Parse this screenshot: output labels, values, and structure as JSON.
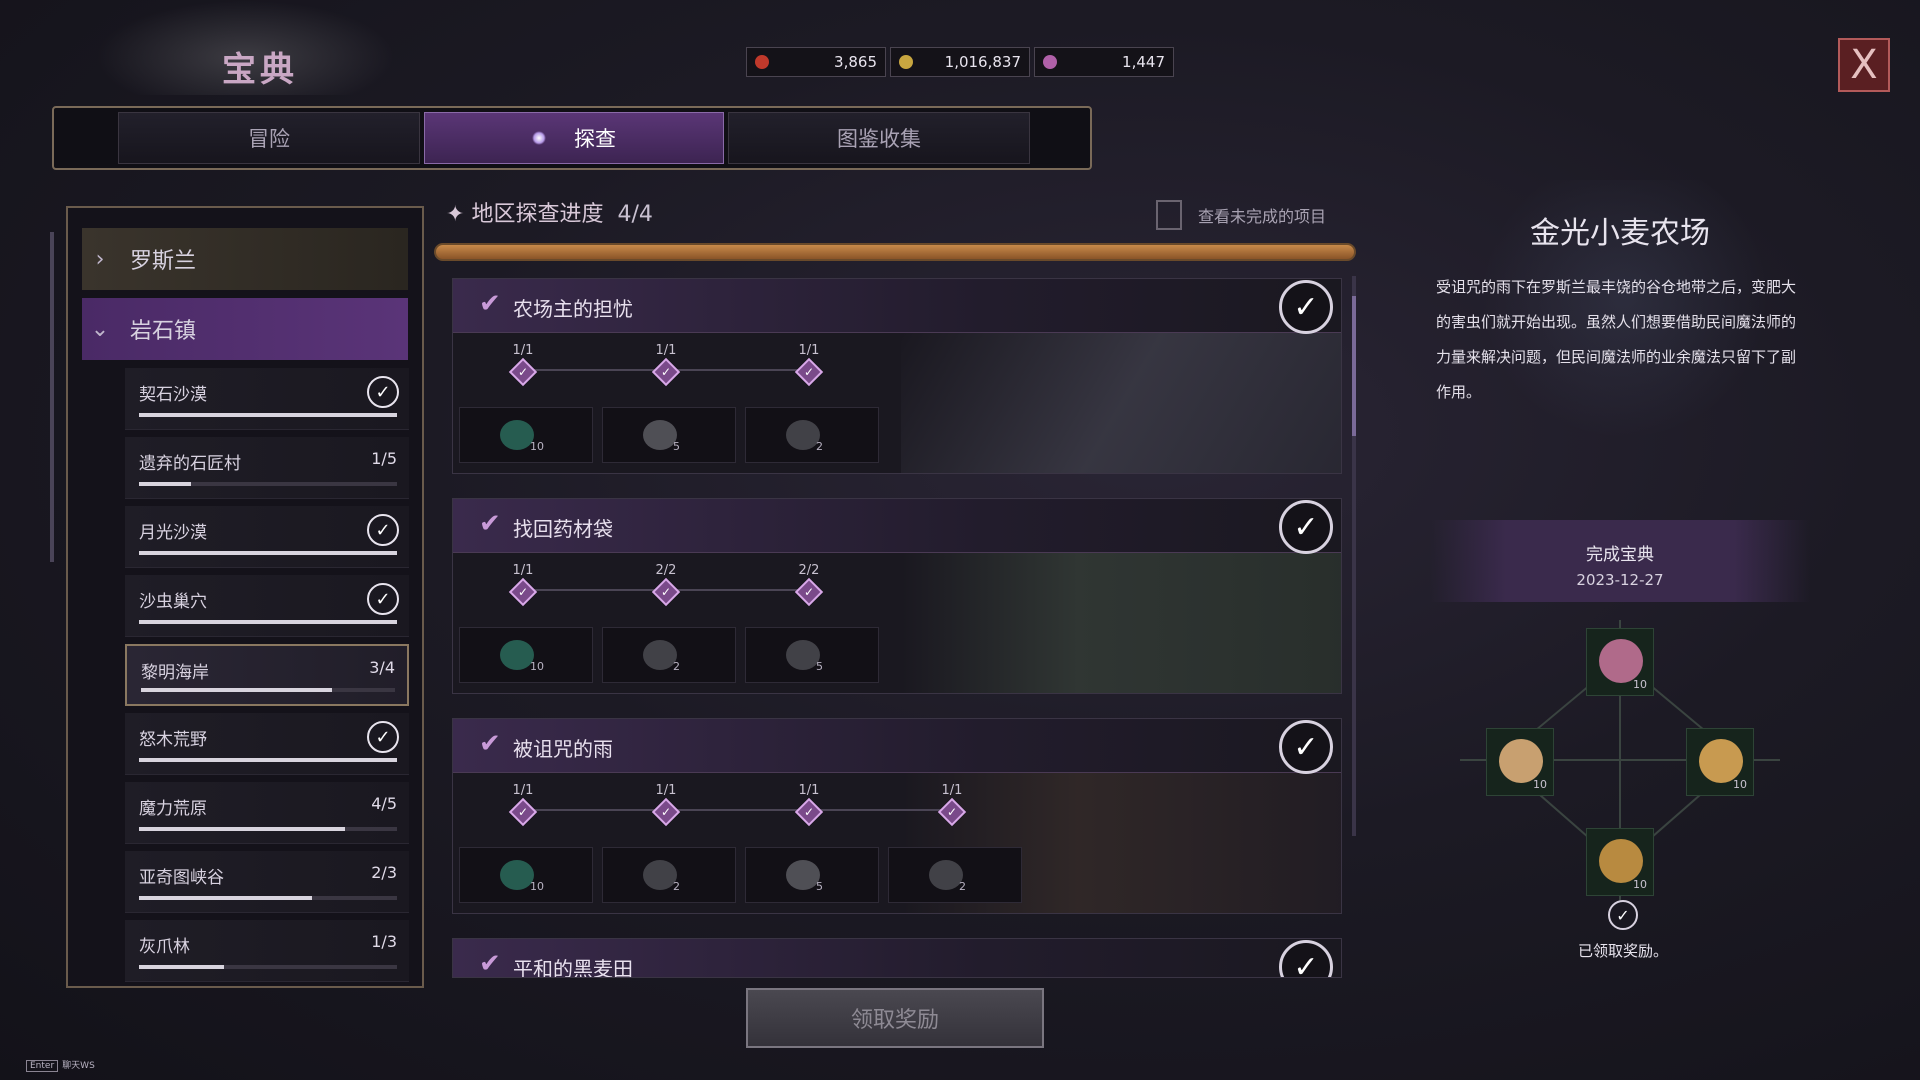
{
  "title": "宝典",
  "currency": [
    {
      "value": "3,865",
      "icon": "ticket-icon",
      "color": "#c0392b"
    },
    {
      "value": "1,016,837",
      "icon": "coin-icon",
      "color": "#c8a640"
    },
    {
      "value": "1,447",
      "icon": "gem-icon",
      "color": "#b060a8"
    }
  ],
  "close_label": "X",
  "tabs": [
    {
      "label": "冒险"
    },
    {
      "label": "探查",
      "active": true
    },
    {
      "label": "图鉴收集"
    }
  ],
  "regions": [
    {
      "label": "罗斯兰",
      "expanded": false
    },
    {
      "label": "岩石镇",
      "expanded": true
    }
  ],
  "areas": [
    {
      "label": "契石沙漠",
      "count": "",
      "done": true,
      "progress": 1
    },
    {
      "label": "遗弃的石匠村",
      "count": "1/5",
      "done": false,
      "progress": 0.2
    },
    {
      "label": "月光沙漠",
      "count": "",
      "done": true,
      "progress": 1
    },
    {
      "label": "沙虫巢穴",
      "count": "",
      "done": true,
      "progress": 1
    },
    {
      "label": "黎明海岸",
      "count": "3/4",
      "done": false,
      "progress": 0.75,
      "selected": true
    },
    {
      "label": "怒木荒野",
      "count": "",
      "done": true,
      "progress": 1
    },
    {
      "label": "魔力荒原",
      "count": "4/5",
      "done": false,
      "progress": 0.8
    },
    {
      "label": "亚奇图峡谷",
      "count": "2/3",
      "done": false,
      "progress": 0.67
    },
    {
      "label": "灰爪林",
      "count": "1/3",
      "done": false,
      "progress": 0.33
    }
  ],
  "main": {
    "header": "地区探查进度",
    "count": "4/4",
    "view_incomplete": "查看未完成的项目"
  },
  "quests": [
    {
      "title": "农场主的担忧",
      "steps": [
        "1/1",
        "1/1",
        "1/1"
      ],
      "rewards": [
        {
          "q": "10",
          "c": "#2a6a5a"
        },
        {
          "q": "5",
          "c": "#5a5a60"
        },
        {
          "q": "2",
          "c": "#4a4a50"
        }
      ]
    },
    {
      "title": "找回药材袋",
      "steps": [
        "1/1",
        "2/2",
        "2/2"
      ],
      "rewards": [
        {
          "q": "10",
          "c": "#2a6a5a"
        },
        {
          "q": "2",
          "c": "#4a4a50"
        },
        {
          "q": "5",
          "c": "#4a4a50"
        }
      ]
    },
    {
      "title": "被诅咒的雨",
      "steps": [
        "1/1",
        "1/1",
        "1/1",
        "1/1"
      ],
      "rewards": [
        {
          "q": "10",
          "c": "#2a6a5a"
        },
        {
          "q": "2",
          "c": "#4a4a50"
        },
        {
          "q": "5",
          "c": "#5a5a60"
        },
        {
          "q": "2",
          "c": "#4a4a50"
        }
      ]
    },
    {
      "title": "平和的黑麦田",
      "steps": [],
      "rewards": []
    }
  ],
  "claim_label": "领取奖励",
  "right": {
    "title": "金光小麦农场",
    "desc": "受诅咒的雨下在罗斯兰最丰饶的谷仓地带之后，变肥大的害虫们就开始出现。虽然人们想要借助民间魔法师的力量来解决问题，但民间魔法师的业余魔法只留下了副作用。",
    "complete_label": "完成宝典",
    "complete_date": "2023-12-27",
    "rewards": [
      {
        "q": "10",
        "icon": "meat-icon",
        "color": "#b06a8a"
      },
      {
        "q": "10",
        "icon": "sandwich-icon",
        "color": "#c8a070"
      },
      {
        "q": "10",
        "icon": "muffin-icon",
        "color": "#c89a50"
      },
      {
        "q": "10",
        "icon": "pastry-icon",
        "color": "#b88a40"
      }
    ],
    "claimed_text": "已领取奖励。"
  },
  "hint": {
    "key": "Enter",
    "text": "聊天WS"
  }
}
